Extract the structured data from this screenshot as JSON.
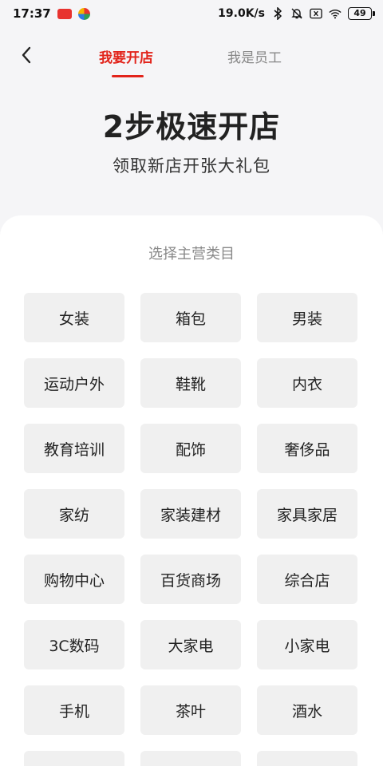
{
  "status_bar": {
    "time": "17:37",
    "net_speed": "19.0K/s",
    "battery": "49",
    "icons": [
      "app-badge-icon",
      "app-colorful-icon",
      "bluetooth-icon",
      "mute-bell-icon",
      "close-box-icon",
      "wifi-icon",
      "battery-icon"
    ]
  },
  "nav": {
    "back_icon": "chevron-left-icon",
    "tabs": [
      {
        "label": "我要开店",
        "active": true
      },
      {
        "label": "我是员工",
        "active": false
      }
    ]
  },
  "hero": {
    "title": "2步极速开店",
    "subtitle": "领取新店开张大礼包"
  },
  "category_card": {
    "title": "选择主营类目",
    "categories": [
      "女装",
      "箱包",
      "男装",
      "运动户外",
      "鞋靴",
      "内衣",
      "教育培训",
      "配饰",
      "奢侈品",
      "家纺",
      "家装建材",
      "家具家居",
      "购物中心",
      "百货商场",
      "综合店",
      "3C数码",
      "大家电",
      "小家电",
      "手机",
      "茶叶",
      "酒水",
      "",
      "",
      ""
    ]
  },
  "colors": {
    "accent": "#e2231a",
    "page_bg": "#f5f5f7",
    "card_bg": "#ffffff",
    "button_bg": "#f0f0f0"
  }
}
